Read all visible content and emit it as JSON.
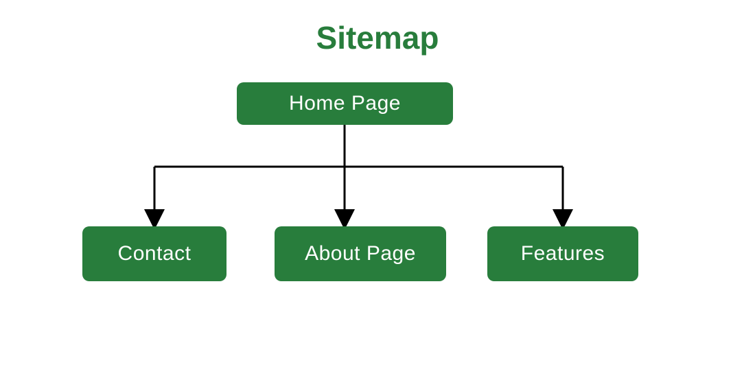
{
  "title": "Sitemap",
  "nodes": {
    "home": "Home Page",
    "contact": "Contact",
    "about": "About Page",
    "features": "Features"
  },
  "colors": {
    "primary": "#287d3c",
    "text": "#ffffff"
  },
  "diagram": {
    "type": "tree",
    "root": "home",
    "children": [
      "contact",
      "about",
      "features"
    ]
  }
}
